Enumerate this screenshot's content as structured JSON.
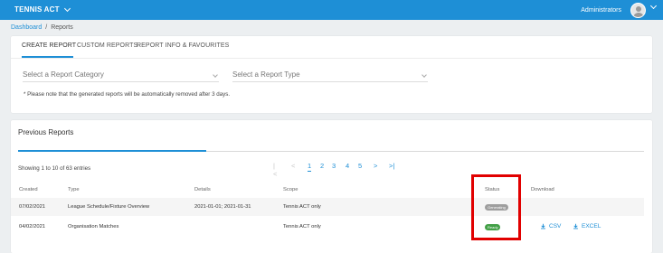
{
  "topbar": {
    "org_name": "TENNIS ACT",
    "user_label": "Administrators"
  },
  "breadcrumb": {
    "home": "Dashboard",
    "separator": "/",
    "current": "Reports"
  },
  "tabs": [
    {
      "label": "CREATE REPORT",
      "active": true
    },
    {
      "label": "CUSTOM REPORTS",
      "active": false
    },
    {
      "label": "REPORT INFO & FAVOURITES",
      "active": false
    }
  ],
  "filters": {
    "category_placeholder": "Select a Report Category",
    "type_placeholder": "Select a Report Type"
  },
  "note": "* Please note that the generated reports will be automatically removed after 3 days.",
  "previous": {
    "title": "Previous Reports",
    "showing": "Showing 1 to 10 of 63 entries",
    "pagination": {
      "first": "|<",
      "prev": "<",
      "pages": [
        "1",
        "2",
        "3",
        "4",
        "5"
      ],
      "current": "1",
      "next": ">",
      "last": ">|"
    },
    "columns": [
      "Created",
      "Type",
      "Details",
      "Scope",
      "Status",
      "Download"
    ],
    "rows": [
      {
        "created": "07/02/2021",
        "type": "League Schedule/Fixture Overview",
        "details": "2021-01-01; 2021-01-31",
        "scope": "Tennis ACT only",
        "status": "Generating",
        "downloads": []
      },
      {
        "created": "04/02/2021",
        "type": "Organisation Matches",
        "details": "",
        "scope": "Tennis ACT only",
        "status": "Ready",
        "downloads": [
          "CSV",
          "EXCEL"
        ]
      }
    ]
  },
  "colors": {
    "primary": "#1e8fd6",
    "highlight": "#e10000",
    "ready": "#43a047",
    "generating": "#9e9e9e"
  }
}
